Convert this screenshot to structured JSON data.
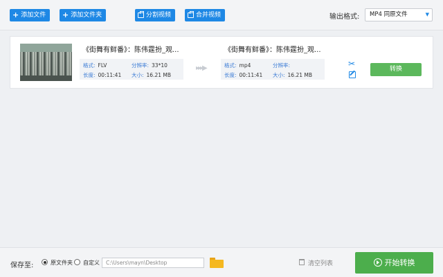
{
  "toolbar": {
    "add_file_label": "添加文件",
    "add_folder_label": "添加文件夹",
    "split_video_label": "分割视频",
    "merge_video_label": "合并视频",
    "output_format_label": "输出格式:",
    "output_format_value": "MP4  同原文件",
    "accent_color": "#1e88e5"
  },
  "file_item": {
    "source": {
      "title": "《街舞有鲜番》：陈伟霆扮_观...",
      "format_key": "格式:",
      "format_value": "FLV",
      "resolution_key": "分辨率:",
      "resolution_value": "33*10",
      "duration_key": "长度:",
      "duration_value": "00:11:41",
      "size_key": "大小:",
      "size_value": "16.21 MB"
    },
    "output": {
      "title": "《街舞有鲜番》：陈伟霆扮_观...",
      "format_key": "格式:",
      "format_value": "mp4",
      "resolution_key": "分辨率:",
      "resolution_value": "",
      "duration_key": "长度:",
      "duration_value": "00:11:41",
      "size_key": "大小:",
      "size_value": "16.21 MB"
    },
    "convert_label": "转换",
    "convert_color": "#5cb85c"
  },
  "bottom": {
    "save_to_label": "保存至:",
    "radio_original_label": "原文件夹",
    "radio_custom_label": "自定义",
    "path_placeholder": "C:\\Users\\mayn\\Desktop",
    "clear_list_label": "清空列表",
    "start_convert_label": "开始转换",
    "start_color": "#4cae4c"
  }
}
